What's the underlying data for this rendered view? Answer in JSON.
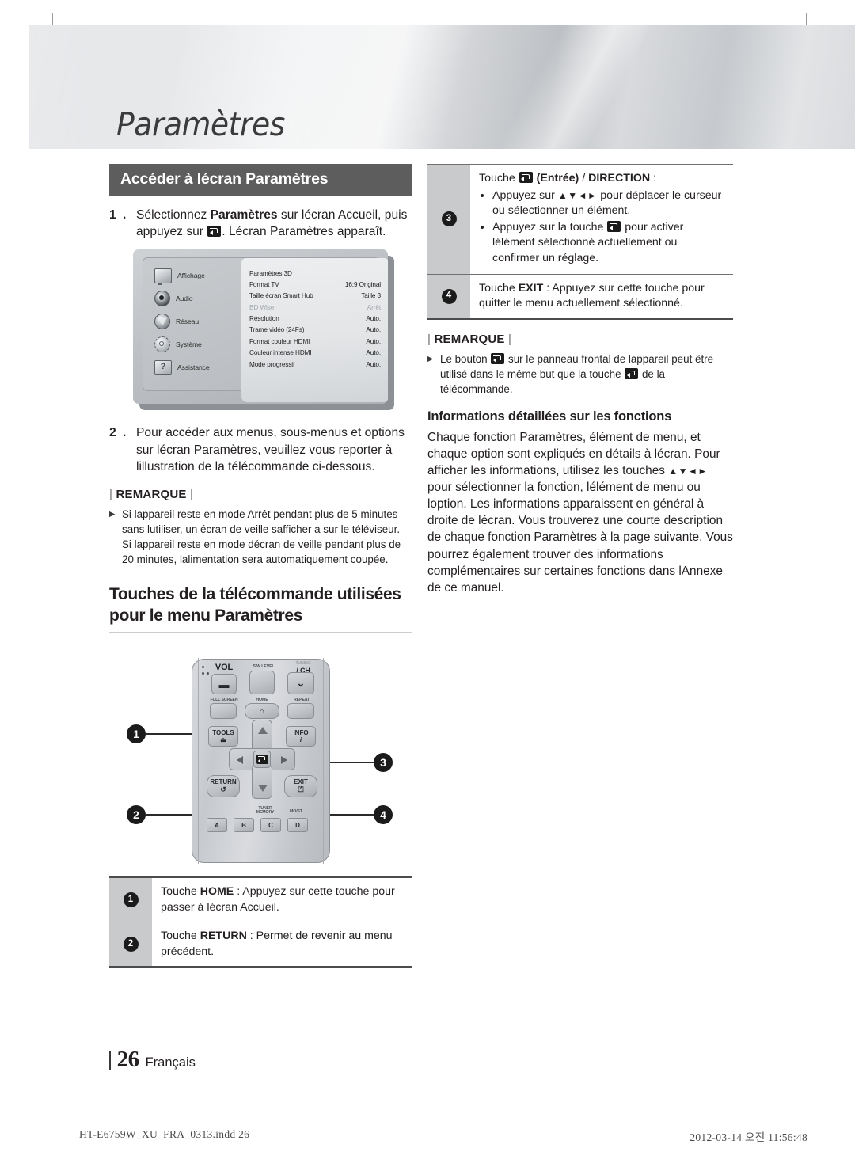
{
  "chapter": {
    "title": "Paramètres"
  },
  "left": {
    "section_header": "Accéder à lécran Paramètres",
    "step1": {
      "num": "1 .",
      "part1": "Sélectionnez ",
      "bold1": "Paramètres",
      "part2": " sur lécran Accueil, puis appuyez sur ",
      "part3": ". Lécran Paramètres apparaît."
    },
    "step2": {
      "num": "2 .",
      "text": "Pour accéder aux menus, sous-menus et options sur lécran Paramètres, veuillez vous reporter à lillustration de la télécommande ci-dessous."
    },
    "remarque_label": "REMARQUE",
    "note1": "Si lappareil reste en mode Arrêt pendant plus de 5 minutes sans lutiliser, un écran de veille safficher a sur le téléviseur. Si lappareil reste en mode décran de veille pendant plus de 20 minutes, lalimentation sera automatiquement coupée.",
    "heading2": "Touches de la télécommande utilisées pour le menu Paramètres"
  },
  "tv_screen": {
    "sidebar": [
      {
        "icon": "display-icon",
        "label": "Affichage"
      },
      {
        "icon": "speaker-icon",
        "label": "Audio"
      },
      {
        "icon": "network-icon",
        "label": "Réseau"
      },
      {
        "icon": "gear-icon",
        "label": "Système"
      },
      {
        "icon": "help-icon",
        "label": "Assistance"
      }
    ],
    "rows": [
      {
        "label": "Paramètres 3D",
        "value": "",
        "dim": false
      },
      {
        "label": "Format TV",
        "value": "16:9 Original",
        "dim": false
      },
      {
        "label": "Taille écran Smart Hub",
        "value": "Taille 3",
        "dim": false
      },
      {
        "label": "BD Wise",
        "value": "Arrêt",
        "dim": true
      },
      {
        "label": "Résolution",
        "value": "Auto.",
        "dim": false
      },
      {
        "label": "Trame vidéo (24Fs)",
        "value": "Auto.",
        "dim": false
      },
      {
        "label": "Format couleur HDMI",
        "value": "Auto.",
        "dim": false
      },
      {
        "label": "Couleur intense HDMI",
        "value": "Auto.",
        "dim": false
      },
      {
        "label": "Mode progressif",
        "value": "Auto.",
        "dim": false
      }
    ]
  },
  "remote": {
    "labels": {
      "vol": "VOL",
      "swlevel": "S/W LEVEL",
      "tuning": "TUNING",
      "ch": "/ CH",
      "fullscreen": "FULL SCREEN",
      "home": "HOME",
      "repeat": "REPEAT",
      "tools": "TOOLS",
      "info": "INFO",
      "return": "RETURN",
      "exit": "EXIT",
      "tuner_memory": "TUNER MEMORY",
      "most": "MO/ST",
      "a": "A",
      "b": "B",
      "c": "C",
      "d": "D"
    },
    "callouts": {
      "one": "1",
      "two": "2",
      "three": "3",
      "four": "4"
    }
  },
  "bottom_table": [
    {
      "num": "1",
      "pre": "Touche ",
      "key": "HOME",
      "post": " : Appuyez sur cette touche pour passer à lécran Accueil."
    },
    {
      "num": "2",
      "pre": "Touche ",
      "key": "RETURN",
      "post": " : Permet de revenir au menu précédent."
    }
  ],
  "right": {
    "row3": {
      "num": "3",
      "head_pre": "Touche ",
      "head_entree": "(Entrée)",
      "head_slash": " / ",
      "head_direction": "DIRECTION",
      "head_colon": " :",
      "bullet1_pre": "Appuyez sur ",
      "bullet1_arrows": "▲▼◄►",
      "bullet1_post": " pour déplacer le curseur ou sélectionner un élément.",
      "bullet2_pre": "Appuyez sur la touche ",
      "bullet2_post": " pour activer lélément sélectionné actuellement ou confirmer un réglage."
    },
    "row4": {
      "num": "4",
      "pre": "Touche ",
      "key": "EXIT",
      "post": " : Appuyez sur cette touche pour quitter le menu actuellement sélectionné."
    },
    "remarque_label": "REMARQUE",
    "note_pre": "Le bouton ",
    "note_mid": " sur le panneau frontal de lappareil peut être utilisé dans le même but que la touche ",
    "note_post": " de la télécommande.",
    "heading3": "Informations détaillées sur les fonctions",
    "para_a": "Chaque fonction Paramètres, élément de menu, et chaque option sont expliqués en détails à lécran. Pour afficher les informations, utilisez les touches ",
    "para_arrows": "▲▼◄►",
    "para_b": " pour sélectionner la fonction, lélément de menu ou loption. Les informations apparaissent en général à droite de lécran. Vous trouverez une courte description de chaque fonction Paramètres à la page suivante. Vous pourrez également trouver des informations complémentaires sur certaines fonctions dans lAnnexe de ce manuel."
  },
  "footer": {
    "page_number": "26",
    "language": "Français",
    "file_name": "HT-E6759W_XU_FRA_0313.indd   26",
    "timestamp": "2012-03-14   오전 11:56:48"
  }
}
